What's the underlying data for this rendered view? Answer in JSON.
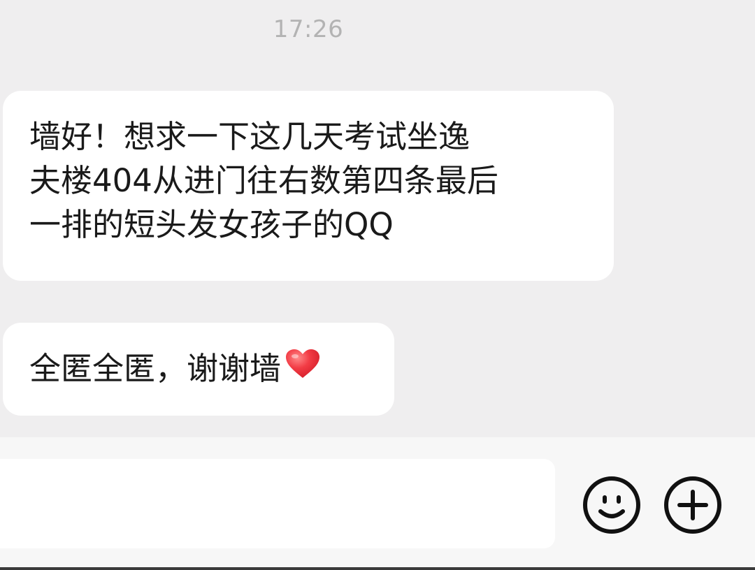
{
  "chat": {
    "timestamp": "17:26",
    "messages": [
      {
        "lines": [
          "墙好！想求一下这几天考试坐逸",
          "夫楼404从进门往右数第四条最后",
          "一排的短头发女孩子的QQ"
        ]
      },
      {
        "text": "全匿全匿，谢谢墙",
        "emoji": "red-heart-icon"
      }
    ]
  },
  "input_bar": {
    "text_value": "",
    "emoji_button_icon": "smiley-face-icon",
    "more_button_icon": "plus-circle-icon"
  },
  "colors": {
    "chat_background": "#efeeef",
    "bubble": "#ffffff",
    "heart": "#f0303a",
    "timestamp": "#b3b3b3"
  }
}
